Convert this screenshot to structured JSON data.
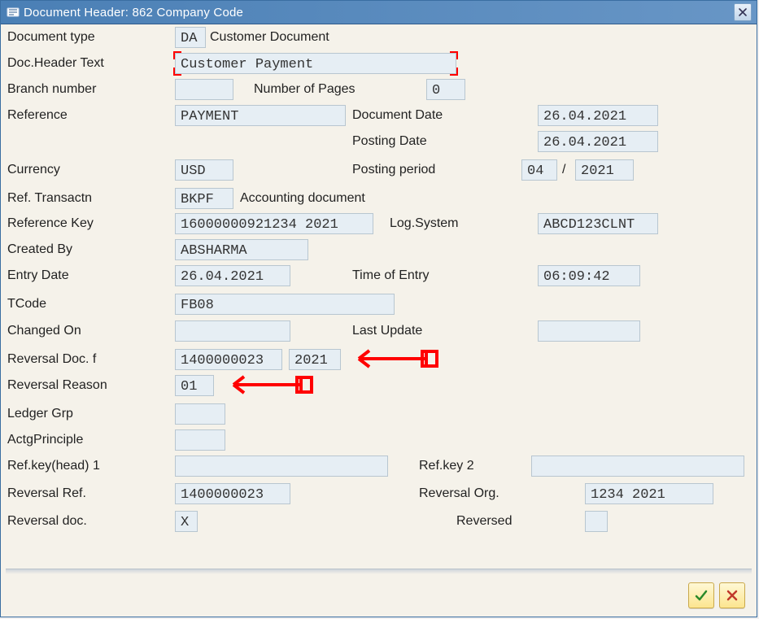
{
  "window": {
    "title": "Document Header: 862 Company Code"
  },
  "labels": {
    "document_type": "Document type",
    "doc_header_text": "Doc.Header Text",
    "branch_number": "Branch number",
    "number_of_pages": "Number of Pages",
    "reference": "Reference",
    "document_date": "Document Date",
    "posting_date": "Posting Date",
    "currency": "Currency",
    "posting_period": "Posting period",
    "ref_transactn": "Ref. Transactn",
    "ref_transactn_desc": "Accounting document",
    "reference_key": "Reference Key",
    "log_system": "Log.System",
    "created_by": "Created By",
    "entry_date": "Entry Date",
    "time_of_entry": "Time of Entry",
    "tcode": "TCode",
    "changed_on": "Changed On",
    "last_update": "Last Update",
    "reversal_doc_f": "Reversal Doc. f",
    "reversal_reason": "Reversal Reason",
    "ledger_grp": "Ledger Grp",
    "actg_principle": "ActgPrinciple",
    "ref_key_head_1": "Ref.key(head) 1",
    "ref_key_2": "Ref.key 2",
    "reversal_ref": "Reversal Ref.",
    "reversal_org": "Reversal Org.",
    "reversal_doc": "Reversal doc.",
    "reversed": "Reversed",
    "document_type_desc": "Customer Document"
  },
  "values": {
    "document_type": "DA",
    "doc_header_text": "Customer Payment",
    "branch_number": "",
    "number_of_pages": "0",
    "reference": "PAYMENT",
    "document_date": "26.04.2021",
    "posting_date": "26.04.2021",
    "currency": "USD",
    "posting_period_month": "04",
    "posting_period_sep": "/",
    "posting_period_year": "2021",
    "ref_transactn": "BKPF",
    "reference_key": "16000000921234 2021",
    "log_system": "ABCD123CLNT",
    "created_by": "ABSHARMA",
    "entry_date": "26.04.2021",
    "time_of_entry": "06:09:42",
    "tcode": "FB08",
    "changed_on": "",
    "last_update": "",
    "reversal_doc_f": "1400000023",
    "reversal_doc_f_year": "2021",
    "reversal_reason": "01",
    "ledger_grp": "",
    "actg_principle": "",
    "ref_key_head_1": "",
    "ref_key_2": "",
    "reversal_ref": "1400000023",
    "reversal_org": "1234 2021",
    "reversal_doc": "X",
    "reversed": ""
  }
}
